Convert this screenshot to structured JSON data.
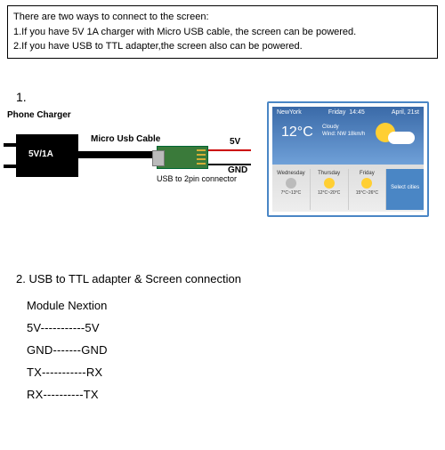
{
  "header": {
    "intro": "There are two ways to connect to the screen:",
    "line1": "1.If you have 5V 1A charger with Micro USB cable, the screen can be powered.",
    "line2": "2.If you have USB to TTL adapter,the screen also can be powered."
  },
  "sections": {
    "one": "1.",
    "two": "2. USB to TTL adapter & Screen connection"
  },
  "diagram1": {
    "charger_label": "Phone Charger",
    "charger_rating": "5V/1A",
    "cable_label": "Micro Usb Cable",
    "board_label": "USB to 2pin connector",
    "wire1": "5V",
    "wire2": "GND"
  },
  "screen_demo": {
    "city": "NewYork",
    "day": "Friday",
    "time": "14:45",
    "date": "April, 21st",
    "temp": "12°C",
    "cond1": "Cloudy",
    "cond2": "Wind: NW 18km/h",
    "forecast": [
      {
        "day": "Wednesday",
        "temp": "7°C~13°C"
      },
      {
        "day": "Thursday",
        "temp": "12°C~20°C"
      },
      {
        "day": "Friday",
        "temp": "15°C~26°C"
      },
      {
        "day": "Select cities",
        "temp": ""
      }
    ]
  },
  "pinout": {
    "header": "Module  Nextion",
    "rows": [
      "5V-----------5V",
      "GND-------GND",
      "TX-----------RX",
      "RX----------TX"
    ]
  }
}
